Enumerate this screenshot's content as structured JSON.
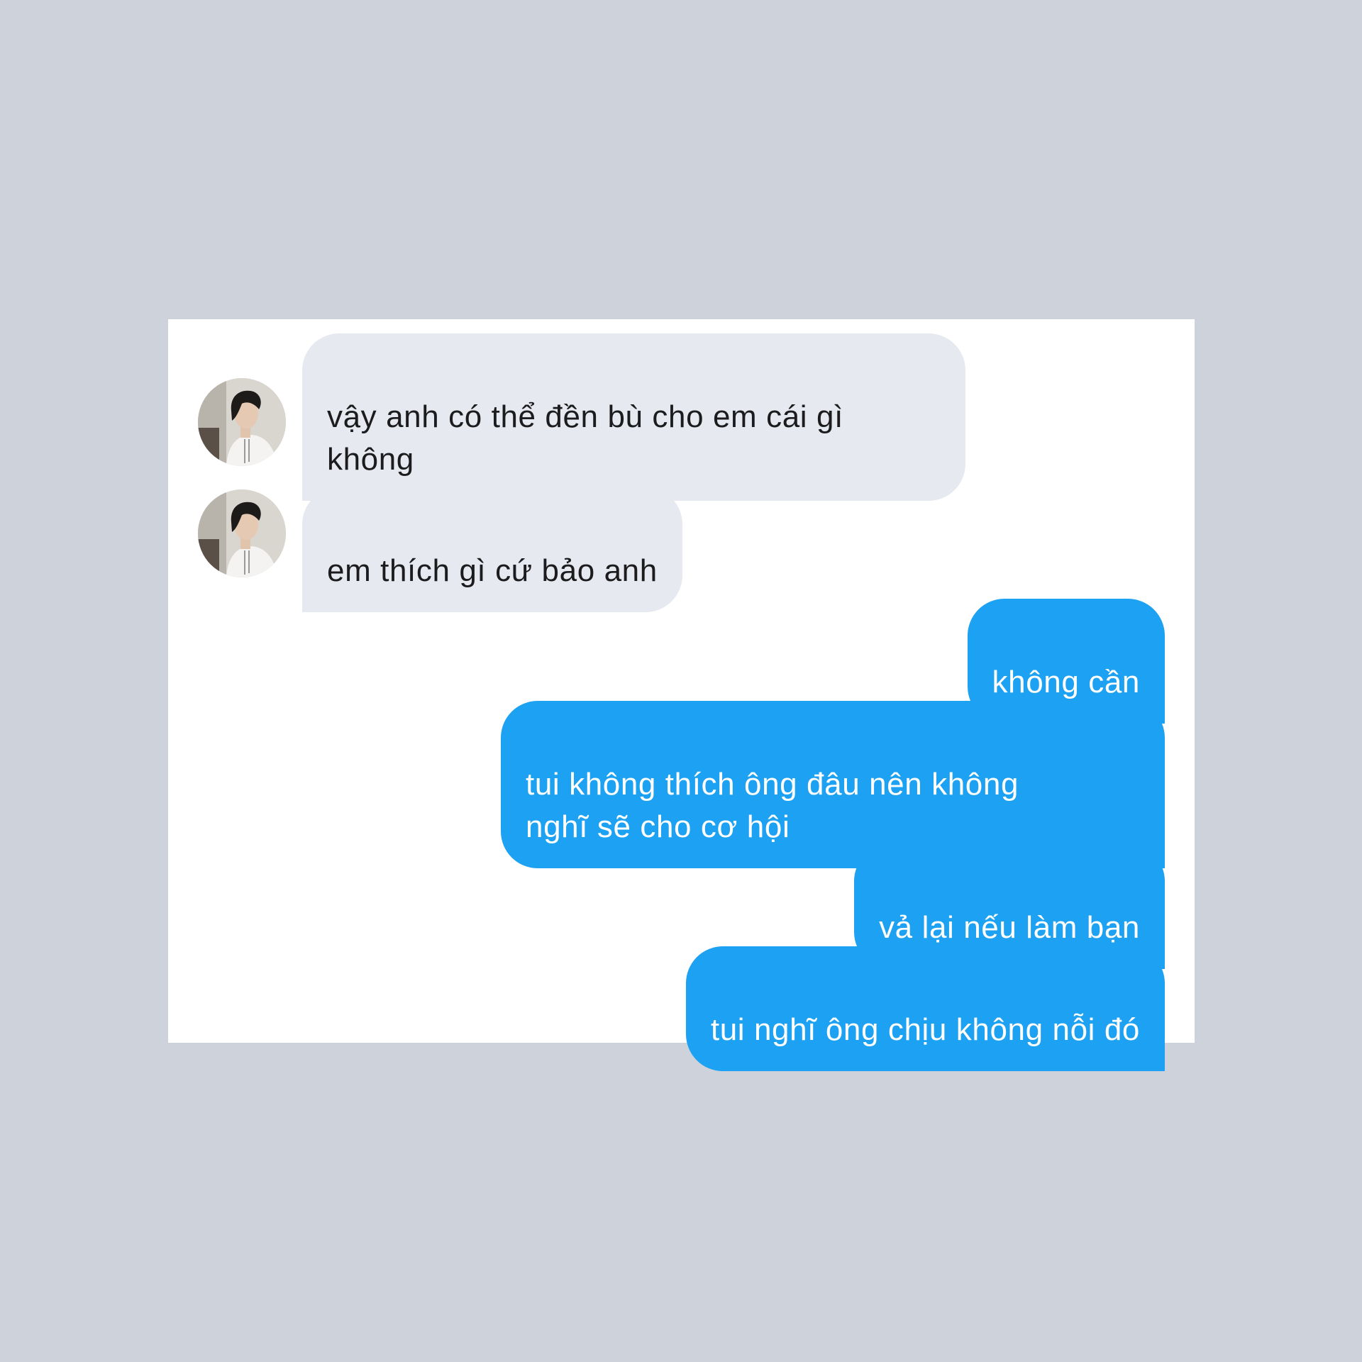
{
  "conversation": {
    "messages": [
      {
        "sender": "them",
        "text": "vậy anh có thể đền bù cho em cái gì\nkhông"
      },
      {
        "sender": "them",
        "text": "em thích gì cứ bảo anh"
      },
      {
        "sender": "me",
        "text": "không cần"
      },
      {
        "sender": "me",
        "text": "tui không thích ông đâu nên không\nnghĩ sẽ cho cơ hội"
      },
      {
        "sender": "me",
        "text": "vả lại nếu làm bạn"
      },
      {
        "sender": "me",
        "text": "tui nghĩ ông chịu không nỗi đó"
      }
    ],
    "colors": {
      "background": "#ced2db",
      "panel": "#ffffff",
      "incoming_bubble": "#e6e9ef",
      "outgoing_bubble": "#1da1f2",
      "incoming_text": "#1c1c1e",
      "outgoing_text": "#ffffff"
    },
    "avatar_icon": "profile-photo"
  }
}
